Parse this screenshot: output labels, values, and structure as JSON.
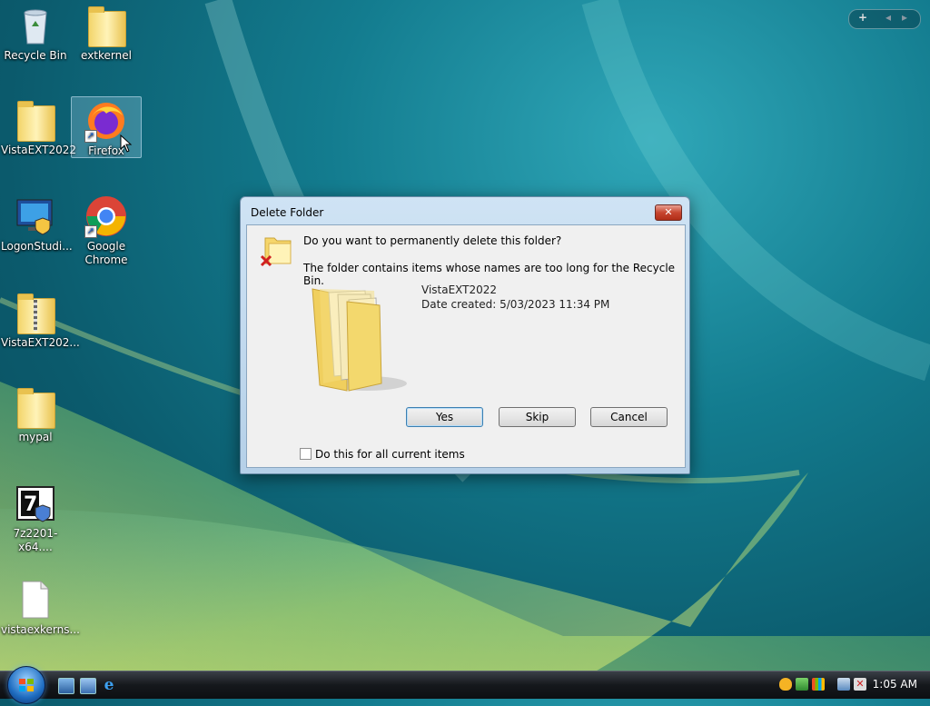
{
  "desktop": {
    "icons": [
      {
        "label": "Recycle Bin"
      },
      {
        "label": "extkernel"
      },
      {
        "label": "VistaEXT2022"
      },
      {
        "label": "Firefox"
      },
      {
        "label": "LogonStudi..."
      },
      {
        "label": "Google Chrome"
      },
      {
        "label": "VistaEXT202..."
      },
      {
        "label": "mypal"
      },
      {
        "label": "7z2201-x64...."
      },
      {
        "label": "vistaexkerns..."
      }
    ]
  },
  "gadget_controls": {
    "add": "+",
    "prev": "◂",
    "next": "▸"
  },
  "dialog": {
    "title": "Delete Folder",
    "close_label": "✕",
    "question": "Do you want to permanently delete this folder?",
    "detail": "The folder contains items whose names are too long for the Recycle Bin.",
    "item_name": "VistaEXT2022",
    "item_date": "Date created: 5/03/2023 11:34 PM",
    "buttons": {
      "yes": "Yes",
      "skip": "Skip",
      "cancel": "Cancel"
    },
    "checkbox_label": "Do this for all current items"
  },
  "taskbar": {
    "clock": "1:05 AM"
  },
  "icons": {
    "recycle": "recycle-bin-icon",
    "folder": "folder-icon",
    "firefox": "firefox-icon",
    "chrome": "chrome-icon",
    "logon": "monitor-shield-icon",
    "zip": "zip-folder-icon",
    "seven_zip": "7zip-installer-icon",
    "file": "blank-file-icon"
  }
}
